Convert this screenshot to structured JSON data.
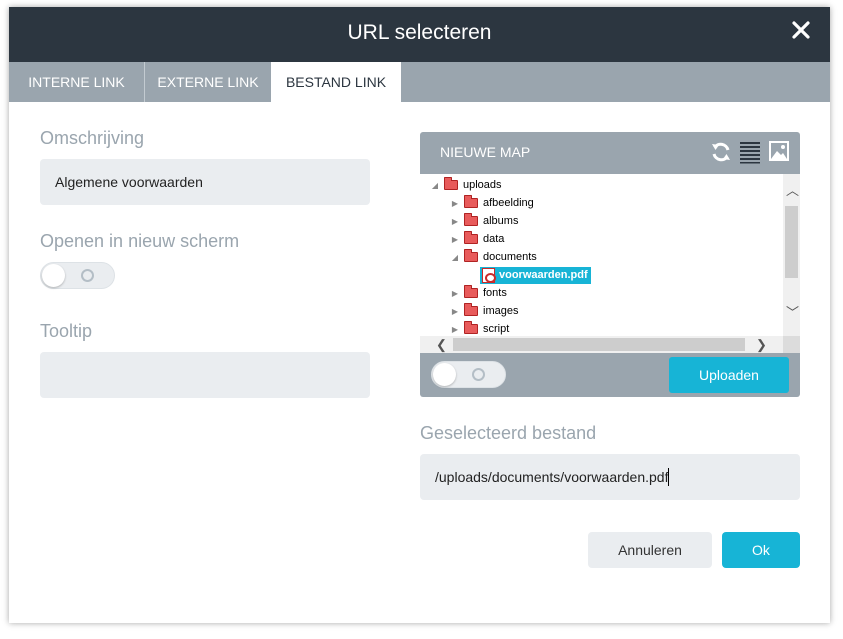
{
  "dialog": {
    "title": "URL selecteren",
    "close_icon": "close-icon"
  },
  "tabs": [
    {
      "label": "INTERNE LINK",
      "active": false
    },
    {
      "label": "EXTERNE LINK",
      "active": false
    },
    {
      "label": "BESTAND LINK",
      "active": true
    }
  ],
  "form": {
    "description_label": "Omschrijving",
    "description_value": "Algemene voorwaarden",
    "new_window_label": "Openen in nieuw scherm",
    "new_window_on": false,
    "tooltip_label": "Tooltip",
    "tooltip_value": ""
  },
  "browser": {
    "new_folder_label": "NIEUWE MAP",
    "icons": [
      "refresh-icon",
      "list-view-icon",
      "image-view-icon"
    ],
    "tree": {
      "root": "uploads",
      "folders": [
        "afbeelding",
        "albums",
        "data",
        "documents",
        "fonts",
        "images",
        "script"
      ],
      "expanded_folder": "documents",
      "selected_file": "voorwaarden.pdf"
    },
    "toggle_on": false,
    "upload_label": "Uploaden"
  },
  "selected": {
    "label": "Geselecteerd bestand",
    "path": "/uploads/documents/voorwaarden.pdf"
  },
  "footer": {
    "cancel_label": "Annuleren",
    "ok_label": "Ok"
  },
  "colors": {
    "header": "#2c3640",
    "tab_bar": "#9aa5ae",
    "accent": "#17b4d6",
    "field_bg": "#eaedf0",
    "label": "#9aa5ae"
  }
}
